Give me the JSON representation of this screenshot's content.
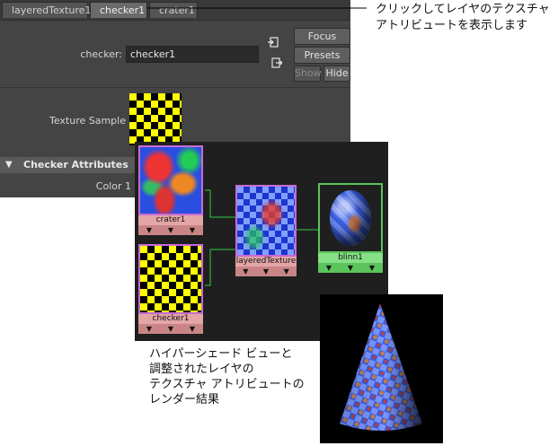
{
  "tabs": [
    "layeredTexture1",
    "checker1",
    "crater1"
  ],
  "checker_label": "checker:",
  "checker_value": "checker1",
  "buttons": {
    "focus": "Focus",
    "presets": "Presets",
    "show": "Show",
    "hide": "Hide"
  },
  "texture_sample_label": "Texture Sample",
  "section_title": "Checker Attributes",
  "color1_label": "Color 1",
  "nodes": {
    "crater": "crater1",
    "checker": "checker1",
    "layered": "layeredTexture",
    "blinn": "blinn1",
    "arrow_glyph": "▼"
  },
  "callout": "クリックしてレイヤのテクスチャ\nアトリビュートを表示します",
  "caption": "ハイパーシェード ビューと\n調整されたレイヤの\nテクスチャ アトリビュートの\nレンダー結果",
  "colors": {
    "panel": "#444444",
    "hypershade_bg": "#1f1f1f",
    "connection": "#2ecc40"
  }
}
